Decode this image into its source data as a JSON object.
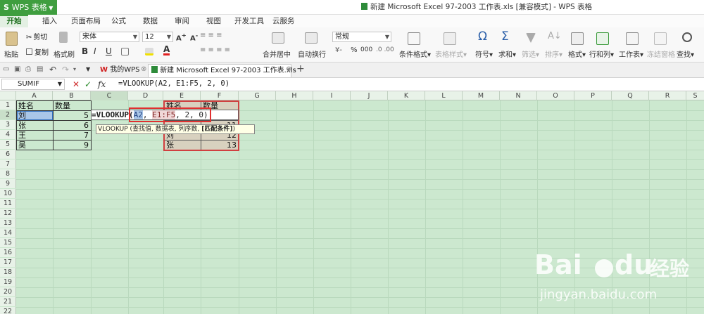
{
  "app": {
    "button_label": "WPS 表格",
    "doc_title": "新建 Microsoft Excel 97-2003 工作表.xls [兼容模式] - WPS 表格"
  },
  "menu": [
    "开始",
    "插入",
    "页面布局",
    "公式",
    "数据",
    "审阅",
    "视图",
    "开发工具",
    "云服务"
  ],
  "ribbon": {
    "paste": "粘贴",
    "cut": "剪切",
    "copy": "复制",
    "format_painter": "格式刷",
    "font_name": "宋体",
    "font_size": "12",
    "bold": "B",
    "italic": "I",
    "underline": "U",
    "merge_center": "合并居中",
    "wrap_text": "自动换行",
    "number_format": "常规",
    "percent": "%",
    "thousands": "000",
    "cond_format": "条件格式",
    "table_style": "表格样式",
    "symbol": "符号",
    "sum": "求和",
    "filter": "筛选",
    "sort": "排序",
    "format": "格式",
    "row_col": "行和列",
    "worksheet": "工作表",
    "freeze": "冻结窗格",
    "find": "查找"
  },
  "tabs": {
    "wps": "我的WPS",
    "doc": "新建 Microsoft Excel 97-2003 工作表.xls"
  },
  "formula_bar": {
    "name_box": "SUMIF",
    "fx": "fx",
    "formula": "=VLOOKUP(A2, E1:F5, 2, 0)"
  },
  "columns": [
    "A",
    "B",
    "C",
    "D",
    "E",
    "F",
    "G",
    "H",
    "I",
    "J",
    "K",
    "L",
    "M",
    "N",
    "O",
    "P",
    "Q",
    "R",
    "S"
  ],
  "rows": [
    "1",
    "2",
    "3",
    "4",
    "5",
    "6",
    "7",
    "8",
    "9",
    "10",
    "11",
    "12",
    "13",
    "14",
    "15",
    "16",
    "17",
    "18",
    "19",
    "20",
    "21",
    "22"
  ],
  "table1": {
    "header": [
      "姓名",
      "数量"
    ],
    "names": [
      "刘",
      "张",
      "王",
      "吴"
    ],
    "values": [
      "5",
      "6",
      "7",
      "9"
    ]
  },
  "table2": {
    "header": [
      "姓名",
      "数量"
    ],
    "names": [
      "",
      "",
      "刘",
      "张"
    ],
    "values": [
      "",
      "11",
      "12",
      "13"
    ]
  },
  "edit_cell": {
    "func": "=VLOOKUP",
    "open": "(",
    "arg1": "A2",
    "sep1": ",",
    "arg2": "E1:F5",
    "rest": ", 2, 0)"
  },
  "tooltip": {
    "text": "VLOOKUP (查找值, 数据表, 列序数, ",
    "bold": "[匹配条件]",
    "close": ")"
  },
  "watermark": {
    "brand": "Bai",
    "du": "du",
    "cn": "经验",
    "url": "jingyan.baidu.com"
  }
}
